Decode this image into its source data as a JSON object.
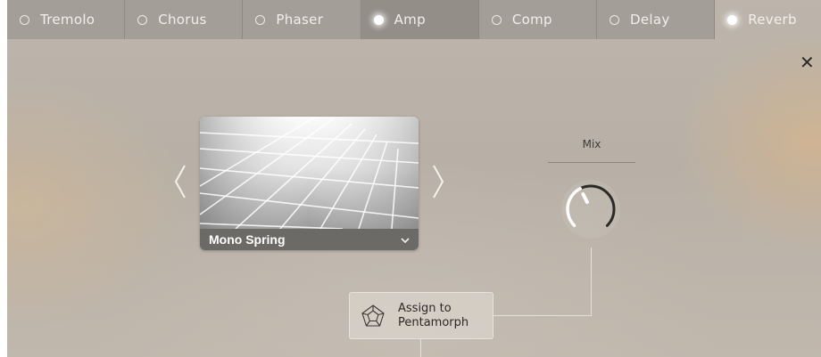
{
  "tabs": [
    {
      "label": "Tremolo",
      "active": false
    },
    {
      "label": "Chorus",
      "active": false
    },
    {
      "label": "Phaser",
      "active": false
    },
    {
      "label": "Amp",
      "active": true
    },
    {
      "label": "Comp",
      "active": false
    },
    {
      "label": "Delay",
      "active": false
    },
    {
      "label": "Reverb",
      "active": true,
      "selected": true
    }
  ],
  "close_label": "✕",
  "preset": {
    "name": "Mono Spring",
    "prev_icon": "chevron-left-icon",
    "next_icon": "chevron-right-icon",
    "dropdown_icon": "chevron-down-icon"
  },
  "mix": {
    "label": "Mix",
    "value": 0.4
  },
  "assign": {
    "line1": "Assign to",
    "line2": "Pentamorph",
    "icon": "pentamorph-icon"
  },
  "colors": {
    "tab_bg": "#a39e97",
    "panel_bg": "#bdb5ab",
    "preset_bar": "#6c6a67"
  }
}
